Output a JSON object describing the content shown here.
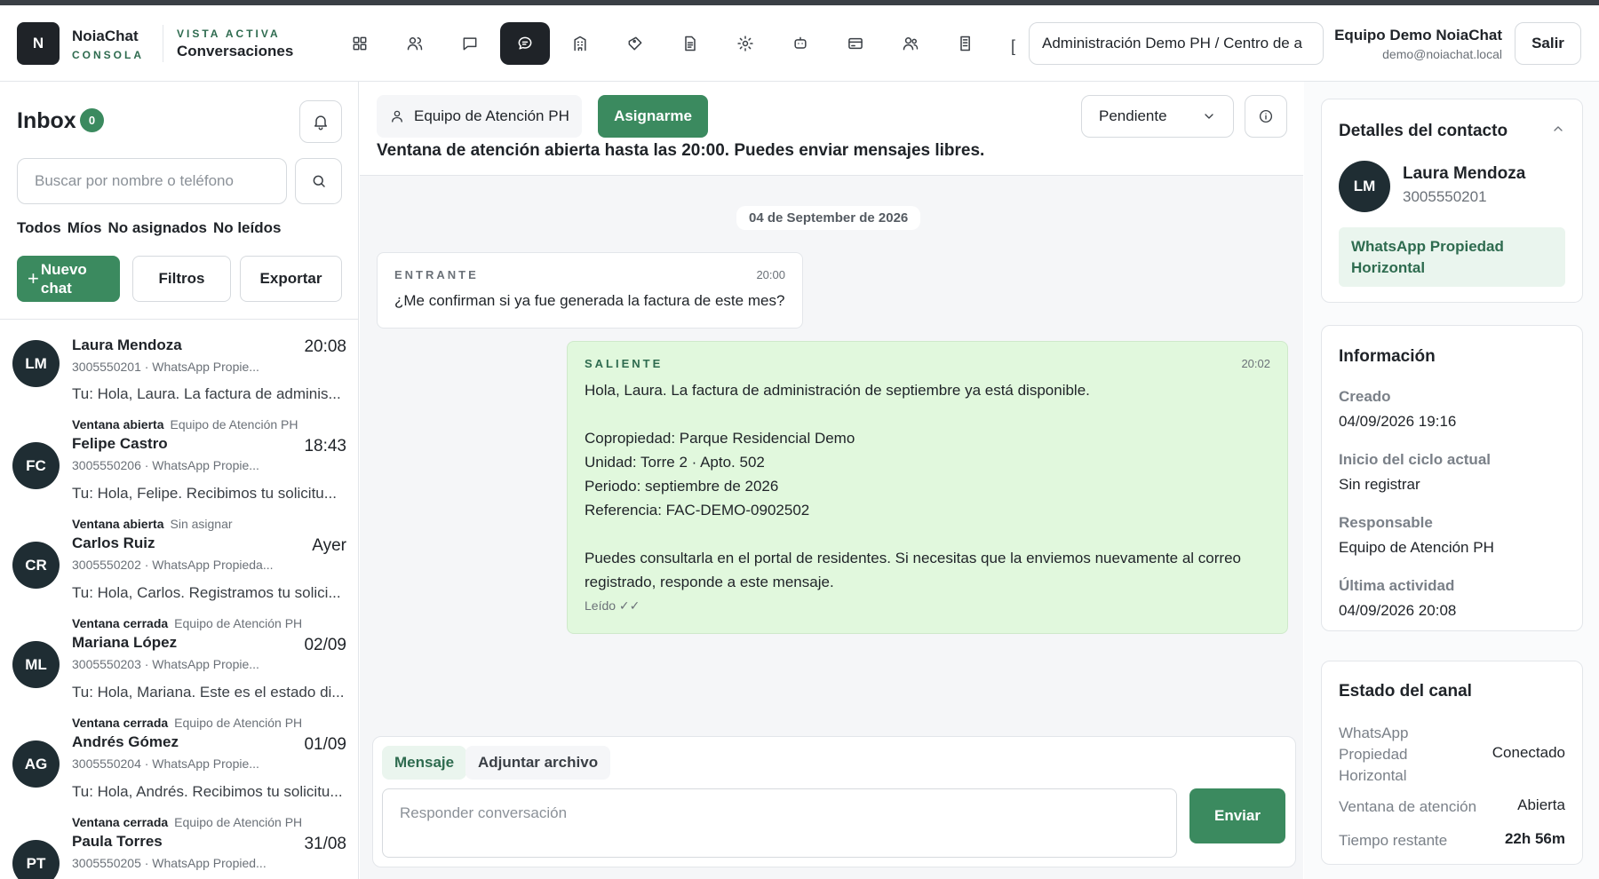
{
  "header": {
    "logo_letter": "N",
    "brand_name": "NoiaChat",
    "brand_sub": "CONSOLA",
    "view_label": "VISTA ACTIVA",
    "view_name": "Conversaciones",
    "nav_icons": [
      "grid-icon",
      "users-icon",
      "chat-bubble-icon",
      "chat-active-icon",
      "building-icon",
      "tag-icon",
      "document-icon",
      "gear-icon",
      "bot-icon",
      "card-icon",
      "team-icon",
      "book-icon"
    ],
    "bracket": "[",
    "org_selector": "Administración Demo PH / Centro de a",
    "user_name": "Equipo Demo NoiaChat",
    "user_email": "demo@noiachat.local",
    "logout": "Salir"
  },
  "sidebar": {
    "inbox_title": "Inbox",
    "inbox_count": "0",
    "search_placeholder": "Buscar por nombre o teléfono",
    "tabs": [
      "Todos",
      "Míos",
      "No asignados",
      "No leídos"
    ],
    "new_chat_line1": "Nuevo",
    "new_chat_line2": "chat",
    "filters": "Filtros",
    "export": "Exportar",
    "conversations": [
      {
        "initials": "LM",
        "status": "",
        "team": "",
        "name": "Laura Mendoza",
        "time": "20:08",
        "phone": "3005550201 · WhatsApp Propie...",
        "preview": "Tu: Hola, Laura. La factura de adminis..."
      },
      {
        "initials": "FC",
        "status": "Ventana abierta",
        "team": "Equipo de Atención PH",
        "name": "Felipe Castro",
        "time": "18:43",
        "phone": "3005550206 · WhatsApp Propie...",
        "preview": "Tu: Hola, Felipe. Recibimos tu solicitu..."
      },
      {
        "initials": "CR",
        "status": "Ventana abierta",
        "team": "Sin asignar",
        "name": "Carlos Ruiz",
        "time": "Ayer",
        "phone": "3005550202 · WhatsApp Propieda...",
        "preview": "Tu: Hola, Carlos. Registramos tu solici..."
      },
      {
        "initials": "ML",
        "status": "Ventana cerrada",
        "team": "Equipo de Atención PH",
        "name": "Mariana López",
        "time": "02/09",
        "phone": "3005550203 · WhatsApp Propie...",
        "preview": "Tu: Hola, Mariana. Este es el estado di..."
      },
      {
        "initials": "AG",
        "status": "Ventana cerrada",
        "team": "Equipo de Atención PH",
        "name": "Andrés Gómez",
        "time": "01/09",
        "phone": "3005550204 · WhatsApp Propie...",
        "preview": "Tu: Hola, Andrés. Recibimos tu solicitu..."
      },
      {
        "initials": "PT",
        "status": "Ventana cerrada",
        "team": "Equipo de Atención PH",
        "name": "Paula Torres",
        "time": "31/08",
        "phone": "3005550205 · WhatsApp Propied...",
        "preview": ""
      }
    ]
  },
  "chat": {
    "team_chip": "Equipo de Atención PH",
    "assign": "Asignarme",
    "status": "Pendiente",
    "window_note": "Ventana de atención abierta hasta las 20:00. Puedes enviar mensajes libres.",
    "date_divider": "04 de September de 2026",
    "incoming": {
      "label": "ENTRANTE",
      "time": "20:00",
      "text": "¿Me confirman si ya fue generada la factura de este mes?"
    },
    "outgoing": {
      "label": "SALIENTE",
      "time": "20:02",
      "lines": [
        "Hola, Laura. La factura de administración de septiembre ya está disponible.",
        "",
        "Copropiedad: Parque Residencial Demo",
        "Unidad: Torre 2 · Apto. 502",
        "Periodo: septiembre de 2026",
        "Referencia: FAC-DEMO-0902502",
        "",
        "Puedes consultarla en el portal de residentes. Si necesitas que la enviemos nuevamente al correo",
        "registrado, responde a este mensaje."
      ],
      "read_status": "Leído ✓✓"
    },
    "composer": {
      "tab_message": "Mensaje",
      "tab_attach": "Adjuntar archivo",
      "placeholder": "Responder conversación",
      "send": "Enviar"
    }
  },
  "contact": {
    "title": "Detalles del contacto",
    "initials": "LM",
    "name": "Laura Mendoza",
    "phone": "3005550201",
    "channel_line1": "WhatsApp Propiedad",
    "channel_line2": "Horizontal"
  },
  "info": {
    "title": "Información",
    "created_label": "Creado",
    "created_value": "04/09/2026 19:16",
    "cycle_label": "Inicio del ciclo actual",
    "cycle_value": "Sin registrar",
    "owner_label": "Responsable",
    "owner_value": "Equipo de Atención PH",
    "last_label": "Última actividad",
    "last_value": "04/09/2026 20:08"
  },
  "channel_status": {
    "title": "Estado del canal",
    "channel_label_1": "WhatsApp",
    "channel_label_2": "Propiedad",
    "channel_label_3": "Horizontal",
    "channel_value": "Conectado",
    "window_label": "Ventana de atención",
    "window_value": "Abierta",
    "remaining_label": "Tiempo restante",
    "remaining_value": "22h 56m"
  },
  "colors": {
    "accent": "#3b8a5f",
    "dark": "#1f2328",
    "bubble_out": "#e1f8dd"
  }
}
